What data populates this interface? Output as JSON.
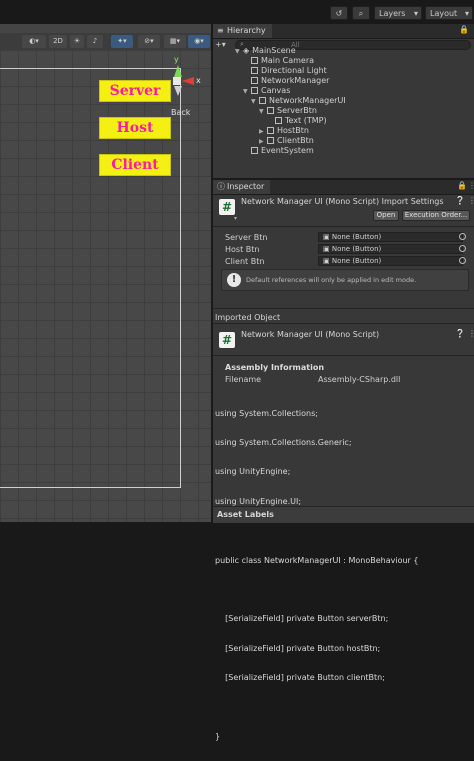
{
  "toolbar": {
    "layers_label": "Layers",
    "layout_label": "Layout"
  },
  "scene_toolbar": {
    "mode_2d": "2D"
  },
  "gizmo": {
    "y_label": "y",
    "x_label": "x",
    "back_label": "Back"
  },
  "game_buttons": {
    "server": "Server",
    "host": "Host",
    "client": "Client"
  },
  "hierarchy": {
    "tab_label": "Hierarchy",
    "search_placeholder": "All",
    "items": [
      {
        "label": "MainScene"
      },
      {
        "label": "Main Camera"
      },
      {
        "label": "Directional Light"
      },
      {
        "label": "NetworkManager"
      },
      {
        "label": "Canvas"
      },
      {
        "label": "NetworkManagerUI"
      },
      {
        "label": "ServerBtn"
      },
      {
        "label": "Text (TMP)"
      },
      {
        "label": "HostBtn"
      },
      {
        "label": "ClientBtn"
      },
      {
        "label": "EventSystem"
      }
    ]
  },
  "inspector": {
    "tab_label": "Inspector",
    "title": "Network Manager UI (Mono Script) Import Settings",
    "open_button": "Open",
    "execution_order_button": "Execution Order...",
    "fields": [
      {
        "label": "Server Btn",
        "value": "None (Button)"
      },
      {
        "label": "Host Btn",
        "value": "None (Button)"
      },
      {
        "label": "Client Btn",
        "value": "None (Button)"
      }
    ],
    "info_message": "Default references will only be applied in edit mode.",
    "imported_object_label": "Imported Object",
    "imported_title": "Network Manager UI (Mono Script)",
    "assembly_section": "Assembly Information",
    "filename_label": "Filename",
    "filename_value": "Assembly-CSharp.dll",
    "code_lines": [
      "using System.Collections;",
      "using System.Collections.Generic;",
      "using UnityEngine;",
      "using UnityEngine.UI;",
      "",
      "public class NetworkManagerUI : MonoBehaviour {",
      "",
      "    [SerializeField] private Button serverBtn;",
      "    [SerializeField] private Button hostBtn;",
      "    [SerializeField] private Button clientBtn;",
      "",
      "}"
    ],
    "asset_labels": "Asset Labels"
  }
}
